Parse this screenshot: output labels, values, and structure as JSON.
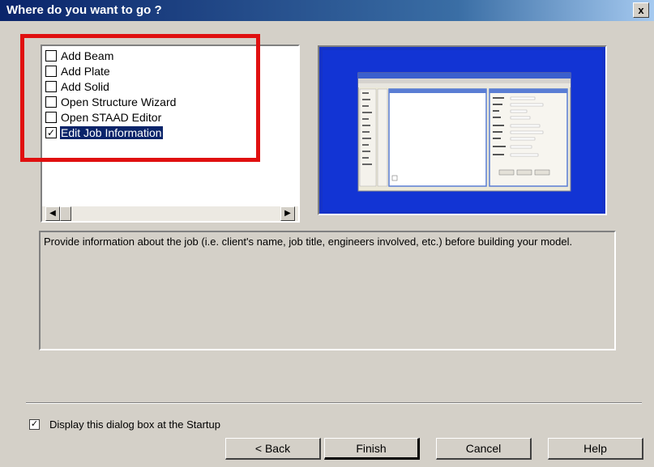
{
  "dialog": {
    "title": "Where do you want to go ?",
    "close_label": "x"
  },
  "options": [
    {
      "label": "Add Beam",
      "checked": false,
      "mark": ""
    },
    {
      "label": "Add Plate",
      "checked": false,
      "mark": ""
    },
    {
      "label": "Add Solid",
      "checked": false,
      "mark": ""
    },
    {
      "label": "Open Structure Wizard",
      "checked": false,
      "mark": ""
    },
    {
      "label": "Open STAAD Editor",
      "checked": false,
      "mark": ""
    },
    {
      "label": "Edit Job Information",
      "checked": true,
      "mark": "✓",
      "selected": true
    }
  ],
  "scroll": {
    "left_arrow": "◀",
    "right_arrow": "▶"
  },
  "description": "Provide information about the job (i.e. client's name, job title, engineers involved, etc.) before building your model.",
  "startup": {
    "label": "Display this dialog box at the Startup",
    "checked": true,
    "mark": "✓"
  },
  "buttons": {
    "back": "< Back",
    "finish": "Finish",
    "cancel": "Cancel",
    "help": "Help"
  },
  "colors": {
    "highlight": "#e01010",
    "preview_bg": "#1432c8",
    "selection": "#0a246a"
  }
}
